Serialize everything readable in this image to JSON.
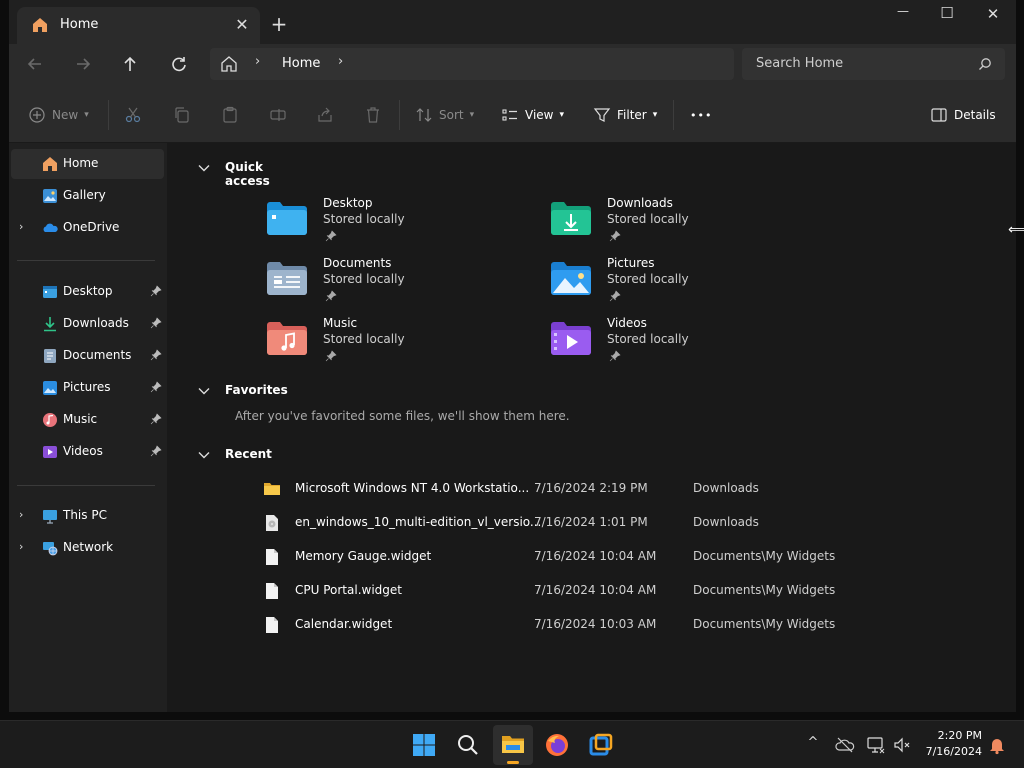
{
  "tab": {
    "title": "Home",
    "close": "✕",
    "new": "+"
  },
  "window_controls": {
    "minimize": "—",
    "maximize": "☐",
    "close": "✕"
  },
  "address": {
    "location": "Home",
    "separator": "›"
  },
  "search": {
    "placeholder": "Search Home"
  },
  "toolbar": {
    "new_label": "New",
    "sort_label": "Sort",
    "view_label": "View",
    "filter_label": "Filter",
    "more_label": "•••",
    "details_label": "Details"
  },
  "sidebar": {
    "items": [
      {
        "label": "Home"
      },
      {
        "label": "Gallery"
      },
      {
        "label": "OneDrive"
      },
      {
        "label": "Desktop"
      },
      {
        "label": "Downloads"
      },
      {
        "label": "Documents"
      },
      {
        "label": "Pictures"
      },
      {
        "label": "Music"
      },
      {
        "label": "Videos"
      },
      {
        "label": "This PC"
      },
      {
        "label": "Network"
      }
    ],
    "expand_glyph": "›"
  },
  "main": {
    "quick_access": {
      "title": "Quick access",
      "items": [
        {
          "name": "Desktop",
          "sub": "Stored locally"
        },
        {
          "name": "Downloads",
          "sub": "Stored locally"
        },
        {
          "name": "Documents",
          "sub": "Stored locally"
        },
        {
          "name": "Pictures",
          "sub": "Stored locally"
        },
        {
          "name": "Music",
          "sub": "Stored locally"
        },
        {
          "name": "Videos",
          "sub": "Stored locally"
        }
      ]
    },
    "favorites": {
      "title": "Favorites",
      "empty_text": "After you've favorited some files, we'll show them here."
    },
    "recent": {
      "title": "Recent",
      "rows": [
        {
          "name": "Microsoft Windows NT 4.0 Workstatio...",
          "date": "7/16/2024 2:19 PM",
          "location": "Downloads"
        },
        {
          "name": "en_windows_10_multi-edition_vl_versio...",
          "date": "7/16/2024 1:01 PM",
          "location": "Downloads"
        },
        {
          "name": "Memory Gauge.widget",
          "date": "7/16/2024 10:04 AM",
          "location": "Documents\\My Widgets"
        },
        {
          "name": "CPU Portal.widget",
          "date": "7/16/2024 10:04 AM",
          "location": "Documents\\My Widgets"
        },
        {
          "name": "Calendar.widget",
          "date": "7/16/2024 10:03 AM",
          "location": "Documents\\My Widgets"
        }
      ]
    }
  },
  "taskbar": {
    "time": "2:20 PM",
    "date": "7/16/2024",
    "tray_chevron": "^"
  },
  "colors": {
    "accent_folder_orange": "#f5a623",
    "window_bg": "#191919",
    "sidebar_bg": "#202020",
    "toolbar_bg": "#2b2b2b"
  }
}
